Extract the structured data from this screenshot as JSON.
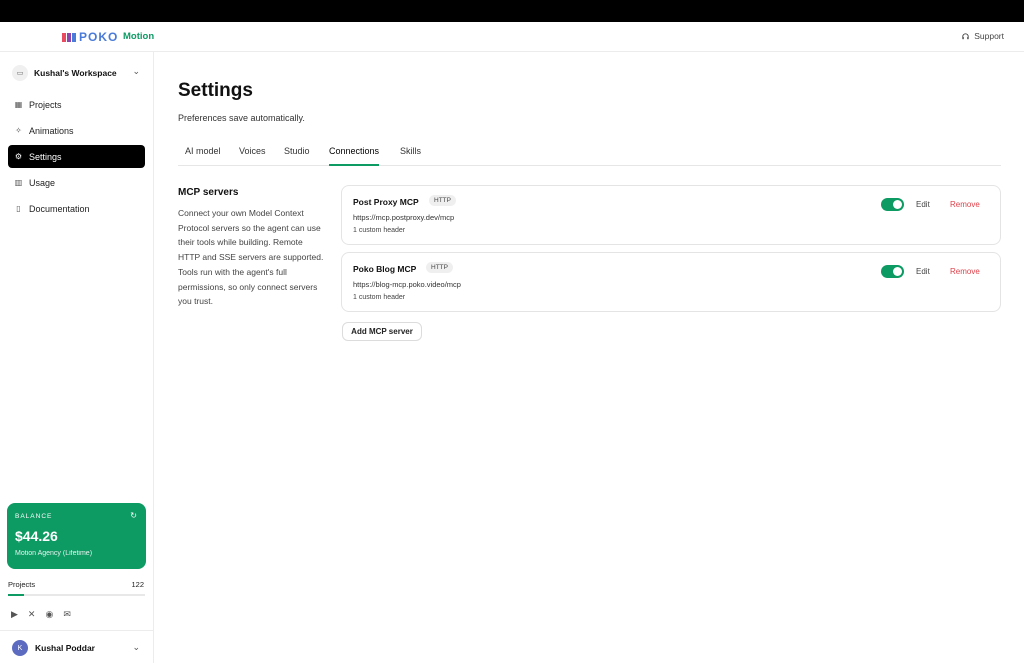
{
  "header": {
    "brand": "POKO",
    "product": "Motion",
    "support_label": "Support"
  },
  "sidebar": {
    "workspace": "Kushal's Workspace",
    "items": [
      {
        "label": "Projects",
        "icon": "grid-icon"
      },
      {
        "label": "Animations",
        "icon": "sparkle-icon"
      },
      {
        "label": "Settings",
        "icon": "gear-icon",
        "active": true
      },
      {
        "label": "Usage",
        "icon": "bar-chart-icon"
      },
      {
        "label": "Documentation",
        "icon": "book-icon"
      }
    ],
    "balance": {
      "label": "BALANCE",
      "amount": "$44.26",
      "plan": "Motion Agency (Lifetime)"
    },
    "projects": {
      "label": "Projects",
      "count": "122",
      "progress_fraction": 0.12
    },
    "user": {
      "initial": "K",
      "name": "Kushal Poddar"
    }
  },
  "main": {
    "title": "Settings",
    "subtitle": "Preferences save automatically.",
    "tabs": [
      {
        "label": "AI model"
      },
      {
        "label": "Voices"
      },
      {
        "label": "Studio"
      },
      {
        "label": "Connections",
        "active": true
      },
      {
        "label": "Skills"
      }
    ],
    "mcp": {
      "title": "MCP servers",
      "description": "Connect your own Model Context Protocol servers so the agent can use their tools while building. Remote HTTP and SSE servers are supported. Tools run with the agent's full permissions, so only connect servers you trust.",
      "servers": [
        {
          "name": "Post Proxy MCP",
          "transport": "HTTP",
          "url": "https://mcp.postproxy.dev/mcp",
          "meta": "1 custom header",
          "enabled": true
        },
        {
          "name": "Poko Blog MCP",
          "transport": "HTTP",
          "url": "https://blog-mcp.poko.video/mcp",
          "meta": "1 custom header",
          "enabled": true
        }
      ],
      "edit_label": "Edit",
      "remove_label": "Remove",
      "add_label": "Add MCP server"
    }
  },
  "colors": {
    "accent": "#0d9a63",
    "danger": "#e0424a",
    "brand_blue": "#4a7bd8"
  }
}
